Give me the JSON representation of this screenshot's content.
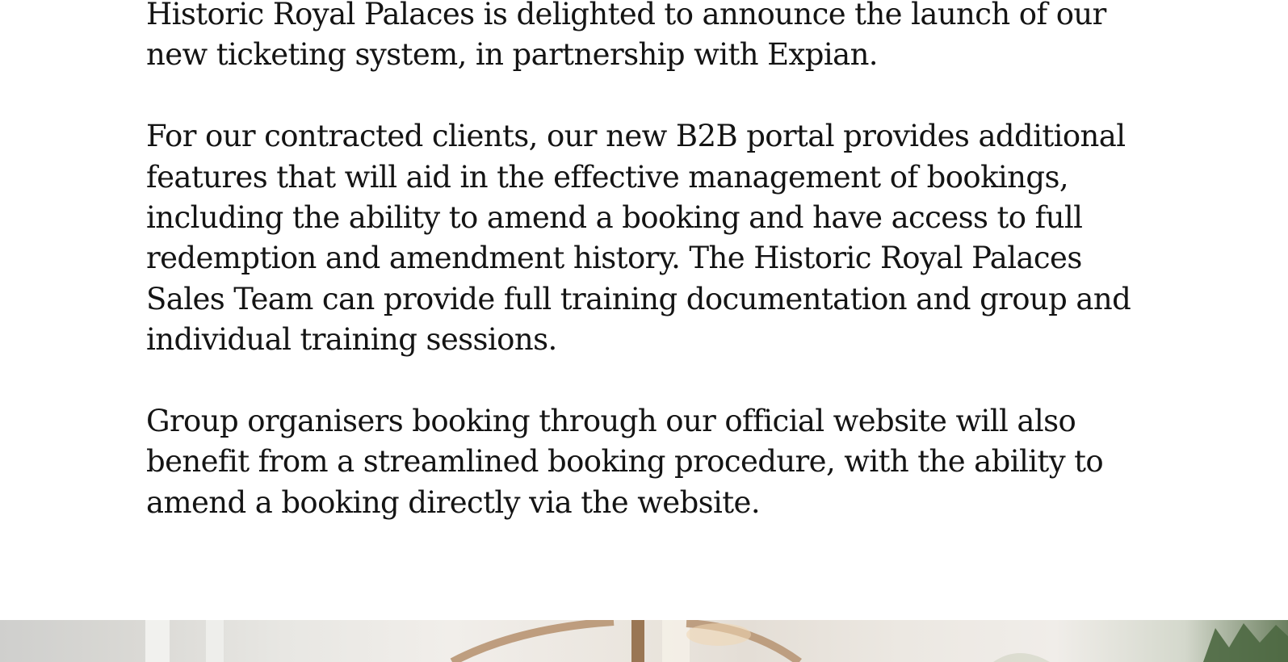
{
  "article": {
    "paragraphs": [
      "Historic Royal Palaces is delighted to announce the launch of our new ticketing system, in partnership with Expian.",
      "For our contracted clients, our new B2B portal provides additional features that will aid in the effective management of bookings, including the ability to amend a booking and have access to full redemption and amendment history. The Historic Royal Palaces Sales Team can provide full training documentation and group and individual training sessions.",
      "Group organisers booking through our official website will also benefit from a streamlined booking procedure, with the ability to amend a booking directly via the website."
    ]
  },
  "colors": {
    "text": "#141414",
    "background": "#ffffff"
  }
}
